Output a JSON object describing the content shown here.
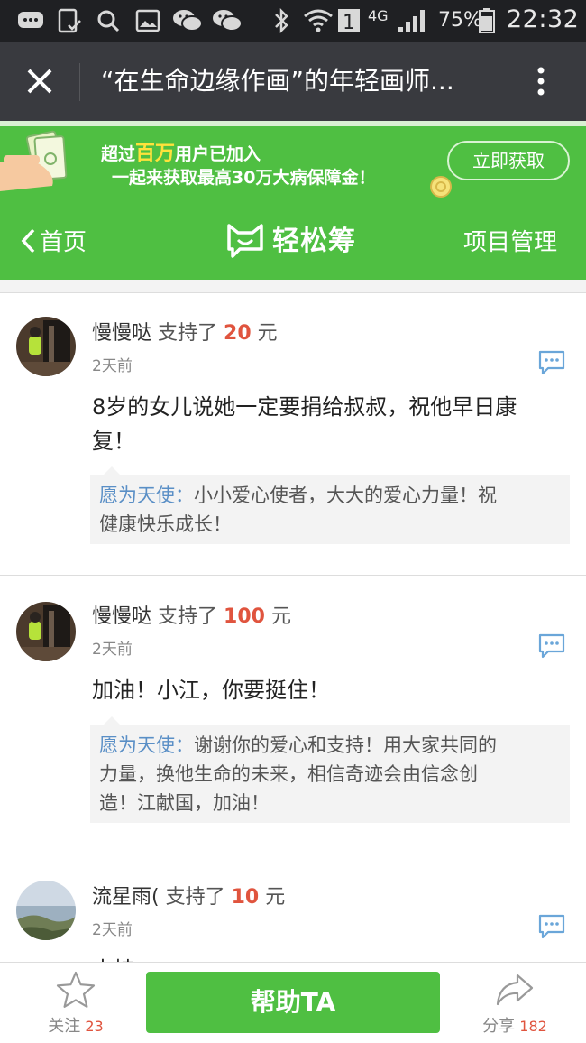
{
  "status_bar": {
    "network": "4G",
    "sim": "1",
    "battery": "75%",
    "time": "22:32"
  },
  "title_bar": {
    "title": "“在生命边缘作画”的年轻画师..."
  },
  "banner": {
    "line1_prefix": "超过",
    "line1_highlight": "百万",
    "line1_suffix": "用户已加入",
    "line2": "一起来获取最高30万大病保障金！",
    "cta": "立即获取"
  },
  "app_nav": {
    "back_label": "首页",
    "logo_name": "轻松筹",
    "manage_label": "项目管理"
  },
  "entries": [
    {
      "user": "慢慢哒",
      "action": "支持了",
      "amount": "20",
      "unit": "元",
      "time": "2天前",
      "message_line1": "8岁的女儿说她一定要捐给叔叔，祝他早日康",
      "message_line2": "复！",
      "reply_name": "愿为天使：",
      "reply_line1": "小小爱心使者，大大的爱心力量！祝",
      "reply_line2": "健康快乐成长！"
    },
    {
      "user": "慢慢哒",
      "action": "支持了",
      "amount": "100",
      "unit": "元",
      "time": "2天前",
      "message_line1": "加油！小江，你要挺住！",
      "reply_name": "愿为天使：",
      "reply_line1": "谢谢你的爱心和支持！用大家共同的",
      "reply_line2": "力量，换他生命的未来，相信奇迹会由信念创",
      "reply_line3": "造！江献国，加油！"
    },
    {
      "user": "流星雨(",
      "action": "支持了",
      "amount": "10",
      "unit": "元",
      "time": "2天前",
      "message_line1": "支持"
    }
  ],
  "bottom_bar": {
    "follow_label": "关注",
    "follow_count": "23",
    "help_button": "帮助TA",
    "share_label": "分享",
    "share_count": "182"
  },
  "colors": {
    "brand_green": "#4fbf42",
    "amount_red": "#e0543e",
    "reply_blue": "#5a8fc6",
    "titlebar": "#393a3f"
  }
}
